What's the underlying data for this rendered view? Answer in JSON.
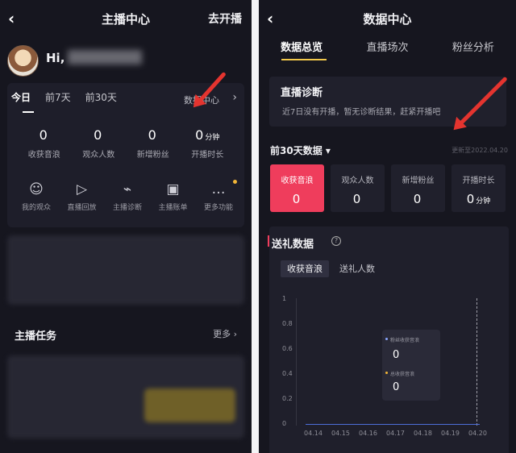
{
  "left": {
    "title": "主播中心",
    "action": "去开播",
    "greeting": "Hi,",
    "tabs": [
      "今日",
      "前7天",
      "前30天"
    ],
    "data_center": "数据中心",
    "stats": [
      {
        "value": "0",
        "unit": "",
        "label": "收获音浪"
      },
      {
        "value": "0",
        "unit": "",
        "label": "观众人数"
      },
      {
        "value": "0",
        "unit": "",
        "label": "新增粉丝"
      },
      {
        "value": "0",
        "unit": "分钟",
        "label": "开播时长"
      }
    ],
    "tools": [
      {
        "icon": "audience-icon",
        "label": "我的观众"
      },
      {
        "icon": "replay-icon",
        "label": "直播回放"
      },
      {
        "icon": "diagnosis-icon",
        "label": "主播诊断"
      },
      {
        "icon": "bill-icon",
        "label": "主播账单"
      },
      {
        "icon": "more-icon",
        "label": "更多功能"
      }
    ],
    "tasks_title": "主播任务",
    "tasks_more": "更多"
  },
  "right": {
    "title": "数据中心",
    "tabs": [
      "数据总览",
      "直播场次",
      "粉丝分析"
    ],
    "diagnosis": {
      "title": "直播诊断",
      "desc": "近7日没有开播，暂无诊断结果，赶紧开播吧"
    },
    "period": "前30天数据",
    "updated": "更新至2022.04.20",
    "metrics": [
      {
        "label": "收获音浪",
        "value": "0",
        "unit": ""
      },
      {
        "label": "观众人数",
        "value": "0",
        "unit": ""
      },
      {
        "label": "新增粉丝",
        "value": "0",
        "unit": ""
      },
      {
        "label": "开播时长",
        "value": "0",
        "unit": "分钟"
      }
    ],
    "gift_title": "送礼数据",
    "chips": [
      "收获音浪",
      "送礼人数"
    ],
    "tooltip": {
      "series1": "粉丝收获音浪",
      "value1": "0",
      "series2": "总收获音浪",
      "value2": "0"
    }
  },
  "chart_data": {
    "type": "line",
    "title": "",
    "x": [
      "04.14",
      "04.15",
      "04.16",
      "04.17",
      "04.18",
      "04.19",
      "04.20"
    ],
    "series": [
      {
        "name": "粉丝收获音浪",
        "values": [
          0,
          0,
          0,
          0,
          0,
          0,
          0
        ]
      },
      {
        "name": "总收获音浪",
        "values": [
          0,
          0,
          0,
          0,
          0,
          0,
          0
        ]
      }
    ],
    "y_ticks": [
      "0",
      "0.2",
      "0.4",
      "0.6",
      "0.8",
      "1"
    ],
    "ylim": [
      0,
      1
    ],
    "grid": false
  },
  "colors": {
    "accent": "#ef3d5c",
    "arrow": "#e4342f",
    "tab_underline": "#f2c84b",
    "chart_line": "#4d6ed9"
  }
}
